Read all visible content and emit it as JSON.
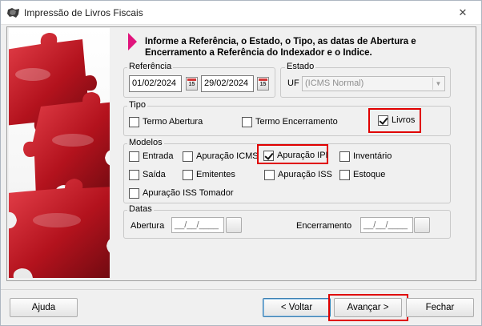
{
  "window": {
    "title": "Impressão de Livros Fiscais",
    "close": "✕"
  },
  "info": {
    "text": "Informe a Referência, o Estado, o Tipo, as datas de Abertura e Encerramento  a Referência do Indexador e o Indice."
  },
  "referencia": {
    "legend": "Referência",
    "start_date": "01/02/2024",
    "end_date": "29/02/2024",
    "calendar_glyph": "15"
  },
  "estado": {
    "legend": "Estado",
    "uf_label": "UF",
    "uf_value": "(ICMS Normal)"
  },
  "tipo": {
    "legend": "Tipo",
    "items": [
      {
        "label": "Termo Abertura",
        "checked": false
      },
      {
        "label": "Termo Encerramento",
        "checked": false
      },
      {
        "label": "Livros",
        "checked": true
      }
    ]
  },
  "modelos": {
    "legend": "Modelos",
    "items": [
      {
        "label": "Entrada",
        "checked": false
      },
      {
        "label": "Apuração ICMS",
        "checked": false
      },
      {
        "label": "Apuração IPI",
        "checked": true
      },
      {
        "label": "Inventário",
        "checked": false
      },
      {
        "label": "Saída",
        "checked": false
      },
      {
        "label": "Emitentes",
        "checked": false
      },
      {
        "label": "Apuração ISS",
        "checked": false
      },
      {
        "label": "Estoque",
        "checked": false
      },
      {
        "label": "Apuração ISS Tomador",
        "checked": false
      }
    ]
  },
  "datas": {
    "legend": "Datas",
    "abertura_label": "Abertura",
    "abertura_value": "__/__/____",
    "encerramento_label": "Encerramento",
    "encerramento_value": "__/__/____"
  },
  "buttons": {
    "ajuda": "Ajuda",
    "voltar": "< Voltar",
    "avancar": "Avançar >",
    "fechar": "Fechar"
  },
  "colors": {
    "highlight": "#e00000",
    "accent": "#e0147c",
    "puzzle": "#b3121d"
  }
}
